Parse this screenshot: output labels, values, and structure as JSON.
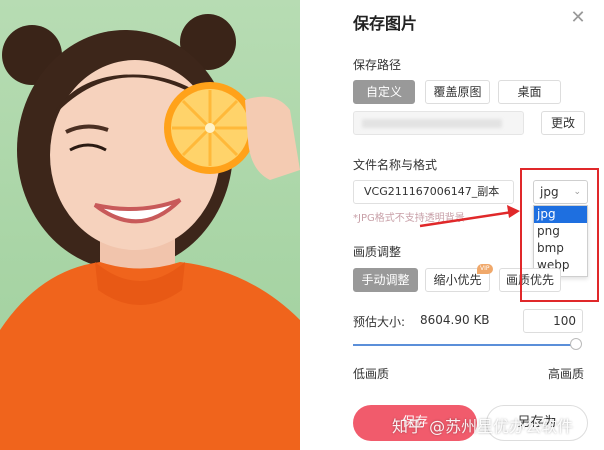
{
  "dialog": {
    "title": "保存图片",
    "close_icon": "close-icon"
  },
  "save_path": {
    "label": "保存路径",
    "options": [
      "自定义",
      "覆盖原图",
      "桌面"
    ],
    "active_option": "自定义",
    "change_label": "更改"
  },
  "file": {
    "label": "文件名称与格式",
    "name_value": "VCG211167006147_副本",
    "hint": "*JPG格式不支持透明背景",
    "format_selected": "jpg",
    "format_options": [
      "jpg",
      "png",
      "bmp",
      "webp"
    ]
  },
  "quality": {
    "label": "画质调整",
    "modes": [
      "手动调整",
      "缩小优先",
      "画质优先"
    ],
    "active_mode": "手动调整",
    "vip_badge": "VIP",
    "size_label": "预估大小:",
    "size_value": "8604.90 KB",
    "quality_value": "100",
    "slider_level_percent": 100,
    "low_label": "低画质",
    "high_label": "高画质"
  },
  "actions": {
    "save_label": "保存",
    "save_as_label": "另存为"
  },
  "watermark": "知乎 @苏州星优办公软件",
  "colors": {
    "accent_red": "#e0282a",
    "save_button": "#f15b6c",
    "active_tab": "#999999",
    "selected_option": "#1e6fe0",
    "slider": "#5b8fd9"
  }
}
